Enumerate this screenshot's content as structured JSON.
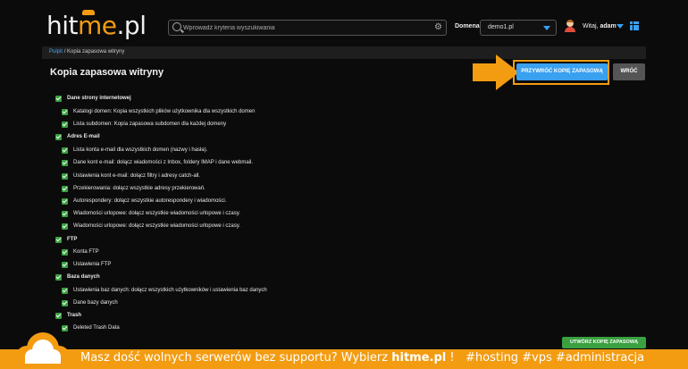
{
  "header": {
    "logo_text_left": "hit",
    "logo_text_accent": "me",
    "logo_text_right": ".pl",
    "search": {
      "placeholder": "Wprowadź kryteria wyszukiwania"
    },
    "domain_label": "Domena",
    "domain_value": "demo1.pl",
    "greeting": "Witaj,",
    "username": "adam",
    "icons": {
      "search": "search-icon",
      "settings": "gear-icon",
      "apps": "grid-icon",
      "user": "avatar-icon"
    },
    "accent_color": "#3aa0f0"
  },
  "breadcrumb": {
    "home": "Pulpit",
    "separator": "/",
    "current": "Kopia zapasowa witryny"
  },
  "page": {
    "title": "Kopia zapasowa witryny",
    "restore_button": "PRZYWRÓĆ KOPIĘ ZAPASOWĄ",
    "back_button": "WRÓĆ",
    "create_button": "UTWÓRZ KOPIĘ ZAPASOWĄ"
  },
  "sections": [
    {
      "label": "Dane strony internetowej",
      "checked": true,
      "items": [
        {
          "label": "Katalogi domen: Kopia wszystkich plików użytkownika dla wszystkich domen",
          "checked": true
        },
        {
          "label": "Lista subdomen: Kopia zapasowa subdomen dla każdej domeny",
          "checked": true
        }
      ]
    },
    {
      "label": "Adres E-mail",
      "checked": true,
      "items": [
        {
          "label": "Lista konta e-mail dla wszystkich domen (nazwy i hasła).",
          "checked": true
        },
        {
          "label": "Dane kont e-mail: dołącz wiadomości z Inbox, foldery IMAP i dane webmail.",
          "checked": true
        },
        {
          "label": "Ustawienia kont e-mail: dołącz filtry i adresy catch-all.",
          "checked": true
        },
        {
          "label": "Przekierowania: dołącz wszystkie adresy przekierowań.",
          "checked": true
        },
        {
          "label": "Autorespondery: dołącz wszystkie autorespondery i wiadomości.",
          "checked": true
        },
        {
          "label": "Wiadomości urlopowe: dołącz wszystkie wiadomości urlopowe i czasy.",
          "checked": true
        },
        {
          "label": "Wiadomości urlopowe: dołącz wszystkie wiadomości urlopowe i czasy.",
          "checked": true
        }
      ]
    },
    {
      "label": "FTP",
      "checked": true,
      "items": [
        {
          "label": "Konta FTP",
          "checked": true
        },
        {
          "label": "Ustawienia FTP",
          "checked": true
        }
      ]
    },
    {
      "label": "Baza danych",
      "checked": true,
      "items": [
        {
          "label": "Ustawienia baz danych: dołącz wszystkich użytkowników i ustawienia baz danych",
          "checked": true
        },
        {
          "label": "Dane bazy danych",
          "checked": true
        }
      ]
    },
    {
      "label": "Trash",
      "checked": true,
      "items": [
        {
          "label": "Deleted Trash Data",
          "checked": true
        }
      ]
    }
  ],
  "promo": {
    "text_before": "Masz dość wolnych serwerów bez supportu? Wybierz",
    "brand": "hitme.pl",
    "text_after": "!",
    "hashtags": "#hosting #vps #administracja",
    "color": "#f39c12"
  },
  "colors": {
    "highlight": "#f39c12",
    "check_green": "#3aa040",
    "restore_blue": "#3aa0f0"
  }
}
